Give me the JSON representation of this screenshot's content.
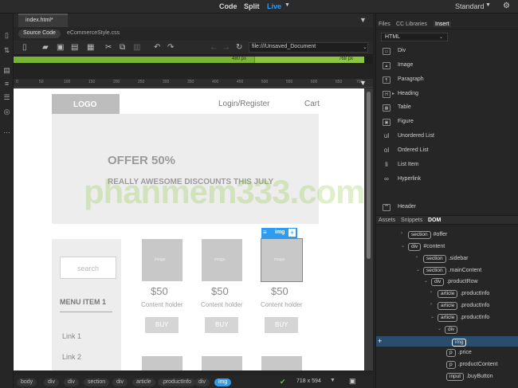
{
  "topbar": {
    "code": "Code",
    "split": "Split",
    "live": "Live",
    "workspace": "Standard"
  },
  "doc": {
    "tab": "index.html*",
    "source_code": "Source Code",
    "related_file": "eCommerceStyle.css",
    "url": "file:///Unsaved_Document"
  },
  "mq": {
    "bar1": "480 px",
    "bar2": "768 px"
  },
  "ruler": [
    "0",
    "50",
    "100",
    "150",
    "200",
    "250",
    "300",
    "350",
    "400",
    "450",
    "500",
    "550",
    "600",
    "650",
    "700"
  ],
  "page": {
    "logo": "LOGO",
    "login": "Login/Register",
    "cart": "Cart",
    "offer_title": "OFFER 50%",
    "offer_sub": "REALLY AWESOME DISCOUNTS THIS JULY",
    "watermark": "phanmem333.com",
    "search_placeholder": "search",
    "menu_item": "MENU ITEM 1",
    "link1": "Link 1",
    "link2": "Link 2",
    "products": [
      {
        "image_label": "image",
        "price": "$50",
        "content": "Content holder",
        "buy": "BUY"
      },
      {
        "image_label": "image",
        "price": "$50",
        "content": "Content holder",
        "buy": "BUY"
      },
      {
        "image_label": "image",
        "price": "$50",
        "content": "Content holder",
        "buy": "BUY"
      }
    ],
    "img_chip": "img",
    "img_chip_plus": "+"
  },
  "status": {
    "crumbs": [
      "body",
      "div",
      "div",
      "section",
      "div",
      "article",
      ".productInfo",
      "div",
      "img"
    ],
    "size": "718 x 594"
  },
  "panel": {
    "tabs": [
      "Files",
      "CC Libraries",
      "Insert"
    ],
    "category": "HTML",
    "insert_items": [
      {
        "icon": "div-icon",
        "label": "Div"
      },
      {
        "icon": "image-icon",
        "label": "Image"
      },
      {
        "icon": "paragraph-icon",
        "label": "Paragraph"
      },
      {
        "icon": "heading-icon",
        "label": "Heading"
      },
      {
        "icon": "table-icon",
        "label": "Table"
      },
      {
        "icon": "figure-icon",
        "label": "Figure"
      },
      {
        "icon": "unordered-list-icon",
        "label": "Unordered List"
      },
      {
        "icon": "ordered-list-icon",
        "label": "Ordered List"
      },
      {
        "icon": "list-item-icon",
        "label": "List Item"
      },
      {
        "icon": "hyperlink-icon",
        "label": "Hyperlink"
      },
      {
        "icon": "header-icon",
        "label": "Header"
      }
    ],
    "dom_tabs": [
      "Assets",
      "Snippets",
      "DOM"
    ],
    "dom_rows": [
      {
        "tag": "section",
        "label": "#offer"
      },
      {
        "tag": "div",
        "label": "#content"
      },
      {
        "tag": "section",
        "label": ".sidebar"
      },
      {
        "tag": "section",
        "label": ".mainContent"
      },
      {
        "tag": "div",
        "label": ".productRow"
      },
      {
        "tag": "article",
        "label": ".productInfo"
      },
      {
        "tag": "article",
        "label": ".productInfo"
      },
      {
        "tag": "article",
        "label": ".productInfo"
      },
      {
        "tag": "div",
        "label": ""
      },
      {
        "tag": "img",
        "label": ""
      },
      {
        "tag": "p",
        "label": ".price"
      },
      {
        "tag": "p",
        "label": ".productContent"
      },
      {
        "tag": "input",
        "label": ".buyButton"
      }
    ]
  },
  "colors": {
    "accent": "#2f9cf0",
    "mq_green": "#8cc63f",
    "selection": "#2a4d6e"
  }
}
